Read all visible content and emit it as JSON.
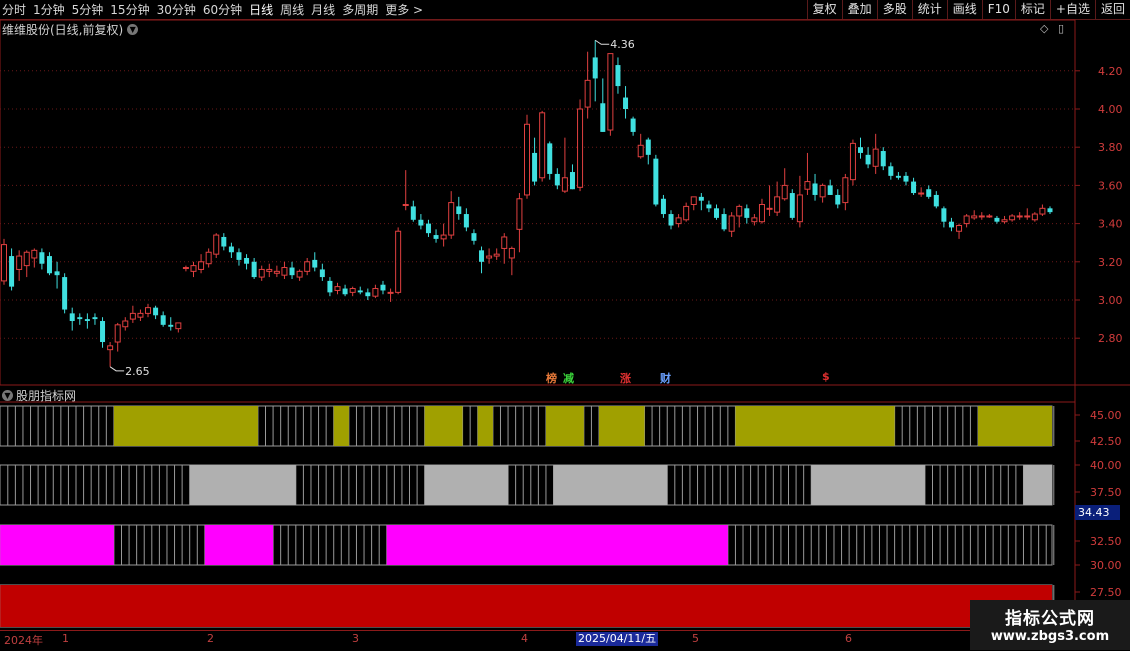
{
  "toolbar": {
    "periods": [
      "分时",
      "1分钟",
      "5分钟",
      "15分钟",
      "30分钟",
      "60分钟",
      "日线",
      "周线",
      "月线",
      "多周期",
      "更多 >"
    ],
    "active_period": "日线",
    "actions": [
      "复权",
      "叠加",
      "多股",
      "统计",
      "画线",
      "F10",
      "标记",
      "+自选",
      "返回"
    ]
  },
  "main_panel": {
    "title": "维维股份(日线,前复权)",
    "icons": [
      "chevron-down-icon",
      "diamond-icon",
      "panel-icon"
    ]
  },
  "indicator_panel": {
    "title": "股朋指标网",
    "cursor_value": "34.43"
  },
  "annotations": {
    "high_label": "4.36",
    "low_label": "2.65"
  },
  "events": [
    {
      "label": "榜",
      "color": "#e87a3a"
    },
    {
      "label": "减",
      "color": "#3ad23a"
    },
    {
      "label": "涨",
      "color": "#e03030"
    },
    {
      "label": "财",
      "color": "#6aa0ff"
    },
    {
      "label": "$",
      "color": "#e03030"
    }
  ],
  "date_axis": {
    "year_label": "2024年",
    "months": [
      "1",
      "2",
      "3",
      "4",
      "5",
      "6"
    ],
    "selected_date": "2025/04/11/五"
  },
  "watermark": {
    "line1": "指标公式网",
    "line2": "www.zbgs3.com"
  },
  "chart_data": {
    "type": "candlestick",
    "price_axis": {
      "ticks": [
        2.8,
        3.0,
        3.2,
        3.4,
        3.6,
        3.8,
        4.0,
        4.2
      ],
      "range": [
        2.6,
        4.4
      ]
    },
    "indicator_axis": {
      "ticks": [
        27.5,
        30.0,
        32.5,
        37.5,
        40.0,
        42.5,
        45.0
      ]
    },
    "colors": {
      "up": "#e04040",
      "down": "#40e0e0",
      "band1": "#a0a000",
      "band2": "#b0b0b0",
      "band3": "#ff00ff",
      "band4": "#c00000"
    },
    "candles": [
      {
        "o": 3.1,
        "h": 3.32,
        "l": 3.08,
        "c": 3.29
      },
      {
        "o": 3.23,
        "h": 3.27,
        "l": 3.05,
        "c": 3.07
      },
      {
        "o": 3.16,
        "h": 3.26,
        "l": 3.1,
        "c": 3.23
      },
      {
        "o": 3.18,
        "h": 3.26,
        "l": 3.12,
        "c": 3.25
      },
      {
        "o": 3.22,
        "h": 3.27,
        "l": 3.17,
        "c": 3.26
      },
      {
        "o": 3.25,
        "h": 3.27,
        "l": 3.16,
        "c": 3.19
      },
      {
        "o": 3.23,
        "h": 3.25,
        "l": 3.13,
        "c": 3.14
      },
      {
        "o": 3.15,
        "h": 3.2,
        "l": 3.06,
        "c": 3.13
      },
      {
        "o": 3.12,
        "h": 3.14,
        "l": 2.93,
        "c": 2.95
      },
      {
        "o": 2.93,
        "h": 2.96,
        "l": 2.84,
        "c": 2.89
      },
      {
        "o": 2.91,
        "h": 2.93,
        "l": 2.87,
        "c": 2.9
      },
      {
        "o": 2.9,
        "h": 2.93,
        "l": 2.85,
        "c": 2.89
      },
      {
        "o": 2.91,
        "h": 2.93,
        "l": 2.87,
        "c": 2.9
      },
      {
        "o": 2.89,
        "h": 2.91,
        "l": 2.75,
        "c": 2.78
      },
      {
        "o": 2.74,
        "h": 2.78,
        "l": 2.65,
        "c": 2.76
      },
      {
        "o": 2.78,
        "h": 2.88,
        "l": 2.73,
        "c": 2.87
      },
      {
        "o": 2.86,
        "h": 2.91,
        "l": 2.84,
        "c": 2.89
      },
      {
        "o": 2.9,
        "h": 2.97,
        "l": 2.88,
        "c": 2.93
      },
      {
        "o": 2.91,
        "h": 2.95,
        "l": 2.89,
        "c": 2.93
      },
      {
        "o": 2.93,
        "h": 2.98,
        "l": 2.91,
        "c": 2.96
      },
      {
        "o": 2.96,
        "h": 2.97,
        "l": 2.9,
        "c": 2.92
      },
      {
        "o": 2.92,
        "h": 2.94,
        "l": 2.86,
        "c": 2.87
      },
      {
        "o": 2.87,
        "h": 2.91,
        "l": 2.84,
        "c": 2.86
      },
      {
        "o": 2.85,
        "h": 2.88,
        "l": 2.83,
        "c": 2.88
      },
      {
        "o": 3.17,
        "h": 3.18,
        "l": 3.15,
        "c": 3.17
      },
      {
        "o": 3.15,
        "h": 3.2,
        "l": 3.12,
        "c": 3.18
      },
      {
        "o": 3.16,
        "h": 3.24,
        "l": 3.14,
        "c": 3.2
      },
      {
        "o": 3.19,
        "h": 3.27,
        "l": 3.17,
        "c": 3.25
      },
      {
        "o": 3.24,
        "h": 3.35,
        "l": 3.22,
        "c": 3.34
      },
      {
        "o": 3.33,
        "h": 3.35,
        "l": 3.26,
        "c": 3.28
      },
      {
        "o": 3.28,
        "h": 3.3,
        "l": 3.22,
        "c": 3.25
      },
      {
        "o": 3.25,
        "h": 3.27,
        "l": 3.18,
        "c": 3.21
      },
      {
        "o": 3.22,
        "h": 3.24,
        "l": 3.16,
        "c": 3.19
      },
      {
        "o": 3.2,
        "h": 3.22,
        "l": 3.11,
        "c": 3.12
      },
      {
        "o": 3.12,
        "h": 3.18,
        "l": 3.1,
        "c": 3.16
      },
      {
        "o": 3.15,
        "h": 3.19,
        "l": 3.12,
        "c": 3.16
      },
      {
        "o": 3.14,
        "h": 3.18,
        "l": 3.12,
        "c": 3.15
      },
      {
        "o": 3.13,
        "h": 3.2,
        "l": 3.11,
        "c": 3.17
      },
      {
        "o": 3.17,
        "h": 3.2,
        "l": 3.11,
        "c": 3.13
      },
      {
        "o": 3.12,
        "h": 3.16,
        "l": 3.1,
        "c": 3.15
      },
      {
        "o": 3.15,
        "h": 3.22,
        "l": 3.13,
        "c": 3.2
      },
      {
        "o": 3.21,
        "h": 3.25,
        "l": 3.15,
        "c": 3.17
      },
      {
        "o": 3.16,
        "h": 3.19,
        "l": 3.1,
        "c": 3.12
      },
      {
        "o": 3.1,
        "h": 3.12,
        "l": 3.02,
        "c": 3.04
      },
      {
        "o": 3.05,
        "h": 3.09,
        "l": 3.03,
        "c": 3.07
      },
      {
        "o": 3.06,
        "h": 3.08,
        "l": 3.02,
        "c": 3.03
      },
      {
        "o": 3.04,
        "h": 3.07,
        "l": 3.02,
        "c": 3.06
      },
      {
        "o": 3.05,
        "h": 3.07,
        "l": 3.03,
        "c": 3.04
      },
      {
        "o": 3.04,
        "h": 3.06,
        "l": 3.0,
        "c": 3.02
      },
      {
        "o": 3.02,
        "h": 3.08,
        "l": 3.01,
        "c": 3.06
      },
      {
        "o": 3.08,
        "h": 3.1,
        "l": 3.03,
        "c": 3.05
      },
      {
        "o": 3.04,
        "h": 3.06,
        "l": 2.99,
        "c": 3.04
      },
      {
        "o": 3.04,
        "h": 3.38,
        "l": 3.03,
        "c": 3.36
      },
      {
        "o": 3.5,
        "h": 3.68,
        "l": 3.47,
        "c": 3.5
      },
      {
        "o": 3.49,
        "h": 3.52,
        "l": 3.41,
        "c": 3.42
      },
      {
        "o": 3.42,
        "h": 3.45,
        "l": 3.37,
        "c": 3.39
      },
      {
        "o": 3.4,
        "h": 3.42,
        "l": 3.33,
        "c": 3.35
      },
      {
        "o": 3.34,
        "h": 3.37,
        "l": 3.3,
        "c": 3.32
      },
      {
        "o": 3.32,
        "h": 3.4,
        "l": 3.28,
        "c": 3.34
      },
      {
        "o": 3.34,
        "h": 3.57,
        "l": 3.32,
        "c": 3.51
      },
      {
        "o": 3.49,
        "h": 3.54,
        "l": 3.42,
        "c": 3.45
      },
      {
        "o": 3.45,
        "h": 3.48,
        "l": 3.36,
        "c": 3.38
      },
      {
        "o": 3.35,
        "h": 3.37,
        "l": 3.29,
        "c": 3.31
      },
      {
        "o": 3.26,
        "h": 3.28,
        "l": 3.14,
        "c": 3.2
      },
      {
        "o": 3.22,
        "h": 3.27,
        "l": 3.19,
        "c": 3.23
      },
      {
        "o": 3.23,
        "h": 3.27,
        "l": 3.21,
        "c": 3.24
      },
      {
        "o": 3.27,
        "h": 3.35,
        "l": 3.19,
        "c": 3.33
      },
      {
        "o": 3.22,
        "h": 3.28,
        "l": 3.13,
        "c": 3.27
      },
      {
        "o": 3.37,
        "h": 3.56,
        "l": 3.25,
        "c": 3.53
      },
      {
        "o": 3.55,
        "h": 3.97,
        "l": 3.53,
        "c": 3.92
      },
      {
        "o": 3.77,
        "h": 3.85,
        "l": 3.6,
        "c": 3.62
      },
      {
        "o": 3.64,
        "h": 3.99,
        "l": 3.62,
        "c": 3.98
      },
      {
        "o": 3.82,
        "h": 3.83,
        "l": 3.63,
        "c": 3.66
      },
      {
        "o": 3.66,
        "h": 3.69,
        "l": 3.58,
        "c": 3.6
      },
      {
        "o": 3.57,
        "h": 3.85,
        "l": 3.56,
        "c": 3.64
      },
      {
        "o": 3.67,
        "h": 3.71,
        "l": 3.58,
        "c": 3.58
      },
      {
        "o": 3.59,
        "h": 4.05,
        "l": 3.57,
        "c": 4.0
      },
      {
        "o": 4.01,
        "h": 4.3,
        "l": 3.95,
        "c": 4.15
      },
      {
        "o": 4.27,
        "h": 4.36,
        "l": 4.04,
        "c": 4.16
      },
      {
        "o": 4.03,
        "h": 4.16,
        "l": 3.88,
        "c": 3.88
      },
      {
        "o": 3.89,
        "h": 4.29,
        "l": 3.86,
        "c": 4.29
      },
      {
        "o": 4.23,
        "h": 4.27,
        "l": 4.08,
        "c": 4.12
      },
      {
        "o": 4.06,
        "h": 4.12,
        "l": 3.95,
        "c": 4.0
      },
      {
        "o": 3.95,
        "h": 3.96,
        "l": 3.86,
        "c": 3.88
      },
      {
        "o": 3.75,
        "h": 3.87,
        "l": 3.74,
        "c": 3.81
      },
      {
        "o": 3.84,
        "h": 3.85,
        "l": 3.71,
        "c": 3.76
      },
      {
        "o": 3.74,
        "h": 3.76,
        "l": 3.49,
        "c": 3.5
      },
      {
        "o": 3.53,
        "h": 3.55,
        "l": 3.43,
        "c": 3.45
      },
      {
        "o": 3.45,
        "h": 3.47,
        "l": 3.37,
        "c": 3.39
      },
      {
        "o": 3.4,
        "h": 3.45,
        "l": 3.38,
        "c": 3.43
      },
      {
        "o": 3.42,
        "h": 3.51,
        "l": 3.41,
        "c": 3.49
      },
      {
        "o": 3.5,
        "h": 3.54,
        "l": 3.47,
        "c": 3.54
      },
      {
        "o": 3.54,
        "h": 3.56,
        "l": 3.47,
        "c": 3.52
      },
      {
        "o": 3.5,
        "h": 3.52,
        "l": 3.46,
        "c": 3.48
      },
      {
        "o": 3.48,
        "h": 3.5,
        "l": 3.42,
        "c": 3.43
      },
      {
        "o": 3.45,
        "h": 3.48,
        "l": 3.36,
        "c": 3.37
      },
      {
        "o": 3.36,
        "h": 3.46,
        "l": 3.33,
        "c": 3.44
      },
      {
        "o": 3.44,
        "h": 3.5,
        "l": 3.38,
        "c": 3.49
      },
      {
        "o": 3.48,
        "h": 3.5,
        "l": 3.4,
        "c": 3.43
      },
      {
        "o": 3.41,
        "h": 3.45,
        "l": 3.39,
        "c": 3.43
      },
      {
        "o": 3.41,
        "h": 3.53,
        "l": 3.4,
        "c": 3.5
      },
      {
        "o": 3.48,
        "h": 3.6,
        "l": 3.44,
        "c": 3.48
      },
      {
        "o": 3.46,
        "h": 3.62,
        "l": 3.44,
        "c": 3.54
      },
      {
        "o": 3.53,
        "h": 3.69,
        "l": 3.52,
        "c": 3.6
      },
      {
        "o": 3.56,
        "h": 3.58,
        "l": 3.42,
        "c": 3.43
      },
      {
        "o": 3.41,
        "h": 3.65,
        "l": 3.38,
        "c": 3.55
      },
      {
        "o": 3.58,
        "h": 3.77,
        "l": 3.55,
        "c": 3.62
      },
      {
        "o": 3.61,
        "h": 3.66,
        "l": 3.52,
        "c": 3.55
      },
      {
        "o": 3.54,
        "h": 3.61,
        "l": 3.51,
        "c": 3.6
      },
      {
        "o": 3.6,
        "h": 3.63,
        "l": 3.55,
        "c": 3.55
      },
      {
        "o": 3.55,
        "h": 3.58,
        "l": 3.48,
        "c": 3.5
      },
      {
        "o": 3.51,
        "h": 3.66,
        "l": 3.47,
        "c": 3.64
      },
      {
        "o": 3.63,
        "h": 3.84,
        "l": 3.6,
        "c": 3.82
      },
      {
        "o": 3.8,
        "h": 3.85,
        "l": 3.74,
        "c": 3.77
      },
      {
        "o": 3.76,
        "h": 3.8,
        "l": 3.69,
        "c": 3.71
      },
      {
        "o": 3.7,
        "h": 3.87,
        "l": 3.66,
        "c": 3.79
      },
      {
        "o": 3.78,
        "h": 3.8,
        "l": 3.68,
        "c": 3.7
      },
      {
        "o": 3.7,
        "h": 3.72,
        "l": 3.63,
        "c": 3.65
      },
      {
        "o": 3.65,
        "h": 3.67,
        "l": 3.63,
        "c": 3.64
      },
      {
        "o": 3.65,
        "h": 3.67,
        "l": 3.6,
        "c": 3.62
      },
      {
        "o": 3.62,
        "h": 3.64,
        "l": 3.55,
        "c": 3.56
      },
      {
        "o": 3.56,
        "h": 3.59,
        "l": 3.54,
        "c": 3.56
      },
      {
        "o": 3.58,
        "h": 3.6,
        "l": 3.53,
        "c": 3.54
      },
      {
        "o": 3.55,
        "h": 3.57,
        "l": 3.48,
        "c": 3.49
      },
      {
        "o": 3.48,
        "h": 3.49,
        "l": 3.38,
        "c": 3.41
      },
      {
        "o": 3.41,
        "h": 3.43,
        "l": 3.36,
        "c": 3.38
      },
      {
        "o": 3.36,
        "h": 3.4,
        "l": 3.32,
        "c": 3.39
      },
      {
        "o": 3.4,
        "h": 3.45,
        "l": 3.38,
        "c": 3.44
      },
      {
        "o": 3.43,
        "h": 3.47,
        "l": 3.42,
        "c": 3.44
      },
      {
        "o": 3.44,
        "h": 3.46,
        "l": 3.42,
        "c": 3.44
      },
      {
        "o": 3.44,
        "h": 3.45,
        "l": 3.43,
        "c": 3.44
      },
      {
        "o": 3.43,
        "h": 3.44,
        "l": 3.4,
        "c": 3.41
      },
      {
        "o": 3.41,
        "h": 3.44,
        "l": 3.4,
        "c": 3.42
      },
      {
        "o": 3.42,
        "h": 3.45,
        "l": 3.41,
        "c": 3.44
      },
      {
        "o": 3.44,
        "h": 3.46,
        "l": 3.42,
        "c": 3.44
      },
      {
        "o": 3.44,
        "h": 3.48,
        "l": 3.42,
        "c": 3.44
      },
      {
        "o": 3.42,
        "h": 3.46,
        "l": 3.41,
        "c": 3.45
      },
      {
        "o": 3.45,
        "h": 3.5,
        "l": 3.44,
        "c": 3.48
      },
      {
        "o": 3.48,
        "h": 3.49,
        "l": 3.45,
        "c": 3.46
      }
    ],
    "bands": [
      {
        "name": "band-1",
        "color": "#a0a000",
        "segments": [
          [
            15,
            33
          ],
          [
            44,
            45
          ],
          [
            56,
            60
          ],
          [
            63,
            64
          ],
          [
            72,
            76
          ],
          [
            79,
            84
          ],
          [
            97,
            117
          ],
          [
            129,
            139
          ]
        ]
      },
      {
        "name": "band-2",
        "color": "#b0b0b0",
        "segments": [
          [
            25,
            38
          ],
          [
            56,
            66
          ],
          [
            73,
            87
          ],
          [
            107,
            121
          ],
          [
            135,
            139
          ]
        ]
      },
      {
        "name": "band-3",
        "color": "#ff00ff",
        "segments": [
          [
            0,
            14
          ],
          [
            27,
            35
          ],
          [
            51,
            95
          ]
        ]
      },
      {
        "name": "band-4",
        "color": "#c00000",
        "segments": [
          [
            0,
            139
          ]
        ]
      }
    ]
  }
}
